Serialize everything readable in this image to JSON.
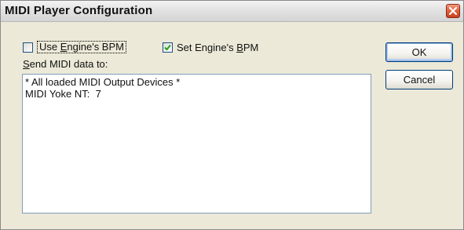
{
  "window": {
    "title": "MIDI Player Configuration"
  },
  "options": {
    "use_engine_bpm": {
      "label_pre": "Use ",
      "label_key": "E",
      "label_post": "ngine's BPM",
      "checked": false
    },
    "set_engine_bpm": {
      "label_pre": "Set Engine's ",
      "label_key": "B",
      "label_post": "PM",
      "checked": true
    }
  },
  "send_label": {
    "key": "S",
    "rest": "end MIDI data to:"
  },
  "devices": [
    "* All loaded MIDI Output Devices *",
    "MIDI Yoke NT:  7"
  ],
  "buttons": {
    "ok": "OK",
    "cancel": "Cancel"
  },
  "colors": {
    "dialog_bg": "#ece9d8",
    "check_mark": "#21a121",
    "close_button": "#d8532f"
  },
  "icons": {
    "close": "close-icon",
    "check": "check-mark-icon"
  }
}
